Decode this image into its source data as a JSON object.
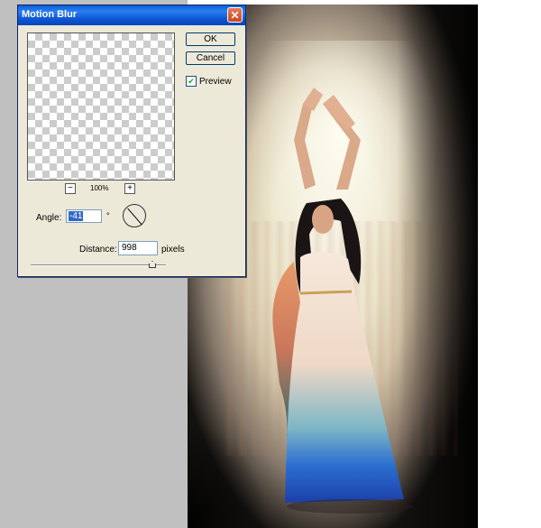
{
  "dialog": {
    "title": "Motion Blur",
    "close_glyph": "✕",
    "ok_label": "OK",
    "cancel_label": "Cancel",
    "preview_label": "Preview",
    "preview_checked": true,
    "zoom": {
      "minus_glyph": "−",
      "plus_glyph": "+",
      "value": "100%"
    },
    "angle": {
      "label": "Angle:",
      "value": "-41",
      "unit": "°"
    },
    "distance": {
      "label": "Distance:",
      "value": "998",
      "unit": "pixels",
      "slider_fraction": 0.998
    }
  },
  "canvas": {
    "subject": "woman-in-flowing-dress-photo"
  },
  "colors": {
    "titlebar": "#0a5fd8",
    "dialog_bg": "#ece9d8",
    "selection": "#316ac5",
    "close_button": "#c9451f"
  }
}
